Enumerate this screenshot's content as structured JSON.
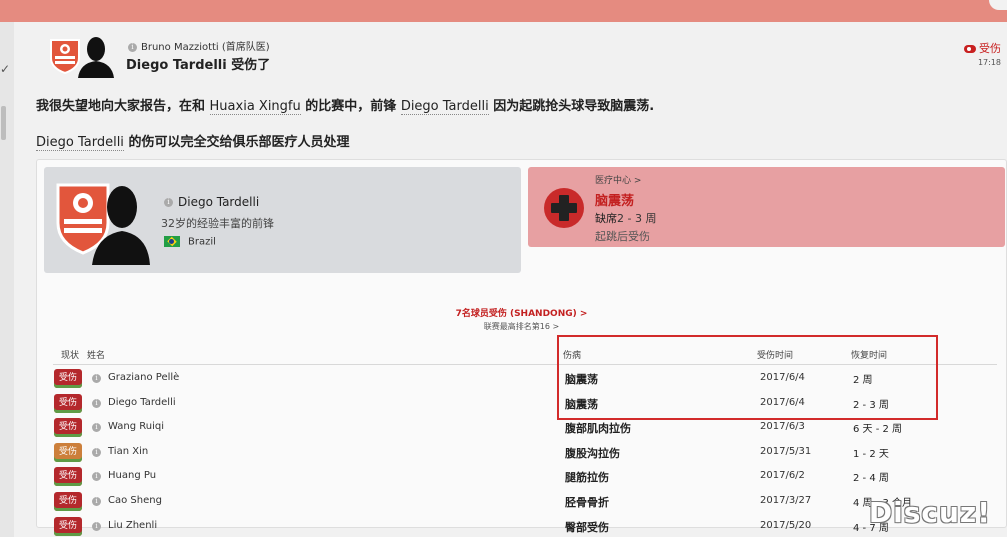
{
  "colors": {
    "accent_red": "#c32020",
    "injury_card_bg": "#e7a0a2",
    "player_card_bg": "#d9dbde",
    "top_bar": "#e58b80",
    "highlight_box": "#d22a2a"
  },
  "header": {
    "sender": "Bruno Mazziotti",
    "sender_role": "(首席队医)",
    "title": "Diego Tardelli 受伤了",
    "status_label": "受伤",
    "time": "17:18"
  },
  "report": {
    "line1_a": "我很失望地向大家报告，在和 ",
    "line1_opponent": "Huaxia Xingfu",
    "line1_b": " 的比赛中，前锋 ",
    "line1_player": "Diego Tardelli",
    "line1_c": " 因为起跳抢头球导致脑震荡.",
    "line2_player": "Diego Tardelli",
    "line2_rest": " 的伤可以完全交给俱乐部医疗人员处理"
  },
  "player_card": {
    "name": "Diego Tardelli",
    "description": "32岁的经验丰富的前锋",
    "nationality": "Brazil"
  },
  "injury_card": {
    "link": "医疗中心 >",
    "injury": "脑震荡",
    "out_label": "缺席",
    "out_duration": "2 - 3 周",
    "cause": "起跳后受伤"
  },
  "table": {
    "summary": "7名球员受伤 (SHANDONG) >",
    "ranking": "联赛最高排名第16 >",
    "columns": {
      "status": "现状",
      "name": "姓名",
      "injury": "伤病",
      "date": "受伤时间",
      "recovery": "恢复时间"
    },
    "rows": [
      {
        "status": "受伤",
        "name": "Graziano Pellè",
        "injury": "脑震荡",
        "date": "2017/6/4",
        "recovery": "2 周"
      },
      {
        "status": "受伤",
        "name": "Diego Tardelli",
        "injury": "脑震荡",
        "date": "2017/6/4",
        "recovery": "2 - 3 周"
      },
      {
        "status": "受伤",
        "name": "Wang Ruiqi",
        "injury": "腹部肌肉拉伤",
        "date": "2017/6/3",
        "recovery": "6 天 - 2 周"
      },
      {
        "status": "受伤",
        "name": "Tian Xin",
        "injury": "腹股沟拉伤",
        "date": "2017/5/31",
        "recovery": "1 - 2 天"
      },
      {
        "status": "受伤",
        "name": "Huang Pu",
        "injury": "腿筋拉伤",
        "date": "2017/6/2",
        "recovery": "2 - 4 周"
      },
      {
        "status": "受伤",
        "name": "Cao Sheng",
        "injury": "胫骨骨折",
        "date": "2017/3/27",
        "recovery": "4 周 - 3 个月"
      },
      {
        "status": "受伤",
        "name": "Liu Zhenli",
        "injury": "臀部受伤",
        "date": "2017/5/20",
        "recovery": "4 - 7 周"
      }
    ]
  },
  "watermark": "Discuz!"
}
